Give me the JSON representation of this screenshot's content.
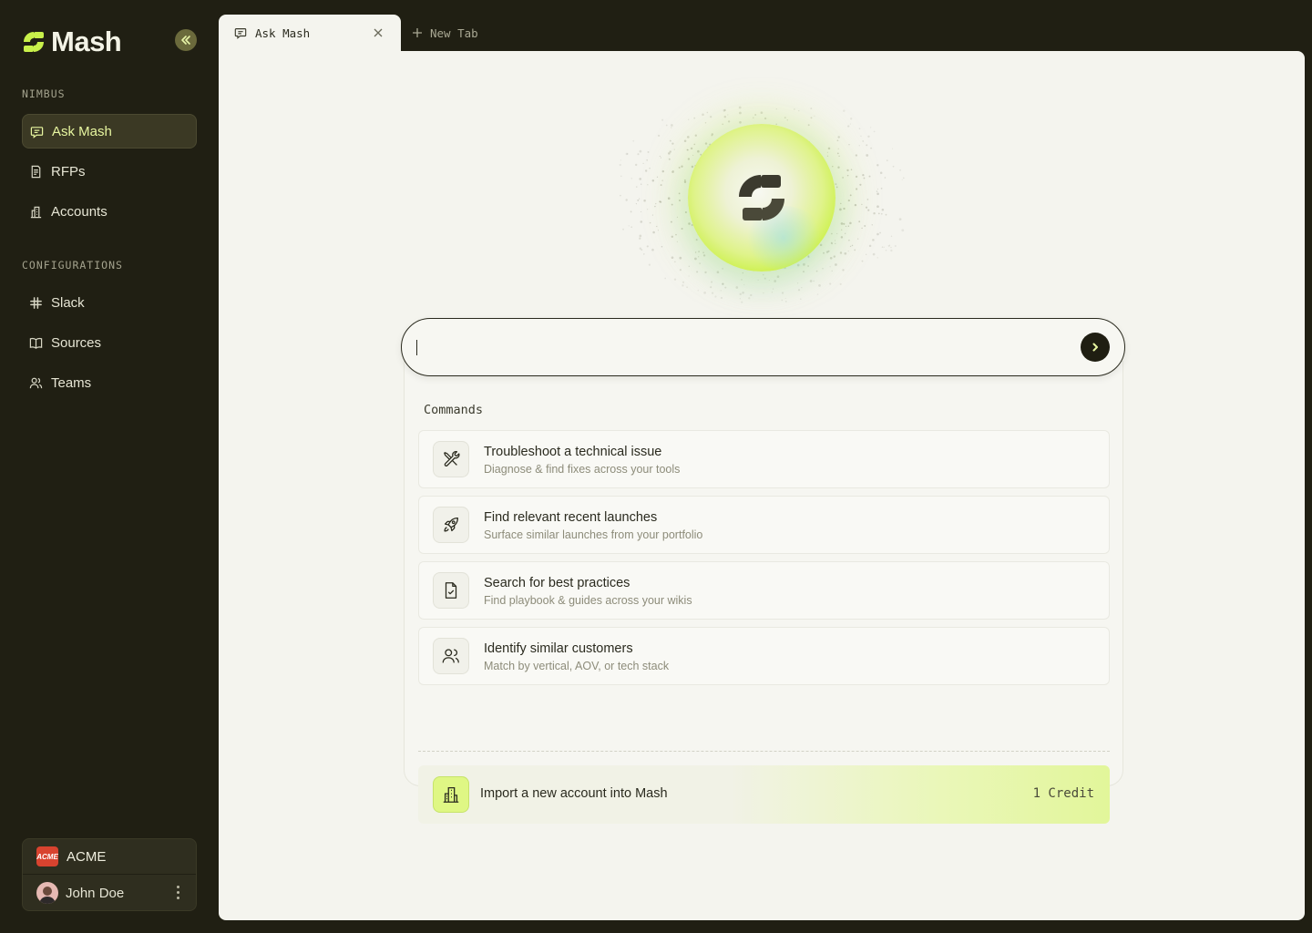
{
  "app": {
    "name": "Mash",
    "brand_color": "#c8f04a",
    "sidebar_bg": "#201f13"
  },
  "sidebar": {
    "sections": [
      {
        "title": "NIMBUS",
        "items": [
          {
            "label": "Ask Mash",
            "icon": "chat-icon",
            "active": true
          },
          {
            "label": "RFPs",
            "icon": "document-icon",
            "active": false
          },
          {
            "label": "Accounts",
            "icon": "building-icon",
            "active": false
          }
        ]
      },
      {
        "title": "CONFIGURATIONS",
        "items": [
          {
            "label": "Slack",
            "icon": "slack-icon",
            "active": false
          },
          {
            "label": "Sources",
            "icon": "book-icon",
            "active": false
          },
          {
            "label": "Teams",
            "icon": "users-icon",
            "active": false
          }
        ]
      }
    ],
    "org": {
      "name": "ACME",
      "logo_text": "ACME"
    },
    "user": {
      "name": "John Doe"
    }
  },
  "tabs": [
    {
      "label": "Ask Mash",
      "active": true
    },
    {
      "label": "New Tab",
      "active": false
    }
  ],
  "search": {
    "value": "",
    "placeholder": ""
  },
  "commands": {
    "title": "Commands",
    "items": [
      {
        "title": "Troubleshoot a technical issue",
        "subtitle": "Diagnose & find fixes across your tools",
        "icon": "tools-icon"
      },
      {
        "title": "Find relevant recent launches",
        "subtitle": "Surface similar launches from your portfolio",
        "icon": "rocket-icon"
      },
      {
        "title": "Search for best practices",
        "subtitle": "Find playbook & guides across your wikis",
        "icon": "file-check-icon"
      },
      {
        "title": "Identify similar customers",
        "subtitle": "Match by vertical, AOV, or tech stack",
        "icon": "users-icon"
      }
    ]
  },
  "import": {
    "label": "Import a new account into Mash",
    "credit": "1 Credit",
    "icon": "building-icon"
  }
}
